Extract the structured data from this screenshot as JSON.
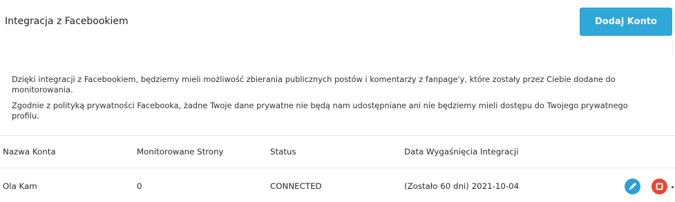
{
  "header": {
    "title": "Integracja z Facebookiem",
    "add_button_label": "Dodaj Konto"
  },
  "info": {
    "paragraph_1": "Dzięki integracji z Facebookiem, będziemy mieli możliwość zbierania publicznych postów i komentarzy z fanpage'y, które zostały przez Ciebie dodane do monitorowania.",
    "paragraph_2": "Zgodnie z polityką prywatności Facebooka, żadne Twoje dane prywatne nie będą nam udostępniane ani nie będziemy mieli dostępu do Twojego prywatnego profilu."
  },
  "table": {
    "columns": [
      "Nazwa Konta",
      "Monitorowane Strony",
      "Status",
      "Data Wygaśnięcia Integracji"
    ],
    "rows": [
      {
        "account_name": "Ola Kam",
        "monitored_pages": "0",
        "status": "CONNECTED",
        "expiry": "(Zostało 60 dni) 2021-10-04",
        "actions": [
          "pencil-icon",
          "stop-icon"
        ]
      }
    ]
  },
  "colors": {
    "primary_button": "#2ea8d8",
    "edit_button": "#2b9fd6",
    "delete_button": "#e9472e"
  }
}
